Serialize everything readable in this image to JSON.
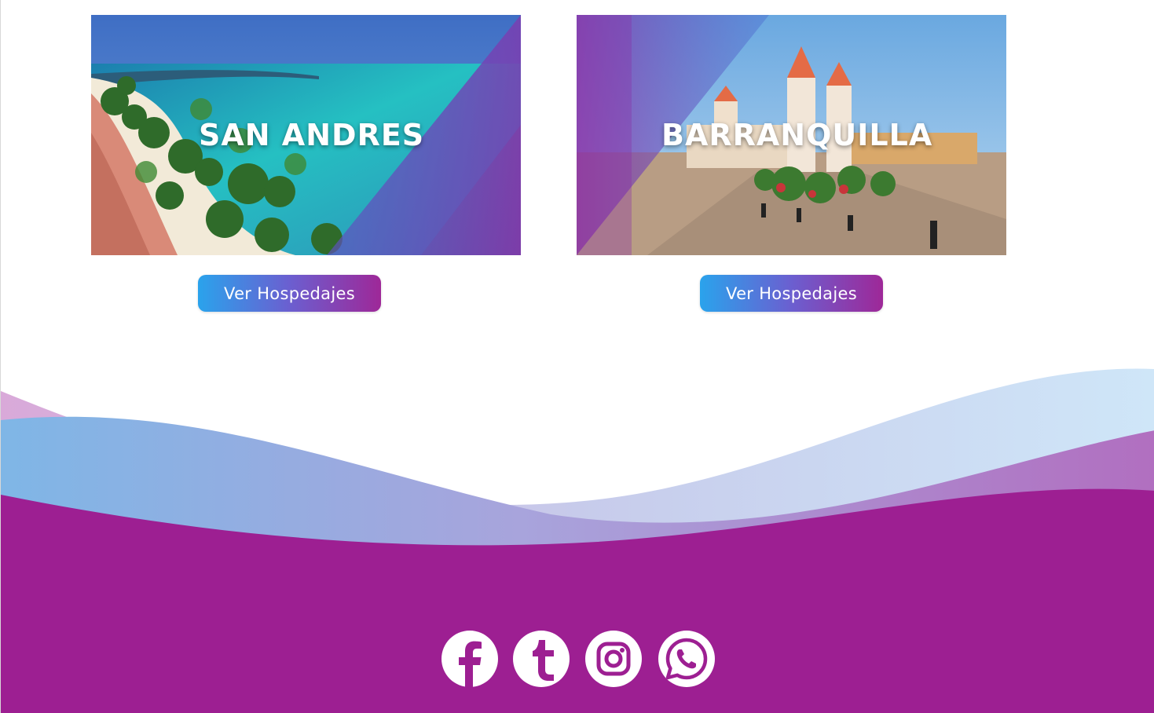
{
  "destinations": [
    {
      "title": "SAN ANDRES",
      "button_label": "Ver Hospedajes"
    },
    {
      "title": "BARRANQUILLA",
      "button_label": "Ver Hospedajes"
    }
  ],
  "footer": {
    "background_color": "#9d1f92",
    "social_icons": [
      "facebook-icon",
      "tumblr-icon",
      "instagram-icon",
      "whatsapp-icon"
    ]
  },
  "colors": {
    "accent_blue": "#2aa3ec",
    "accent_purple": "#9e2898"
  }
}
